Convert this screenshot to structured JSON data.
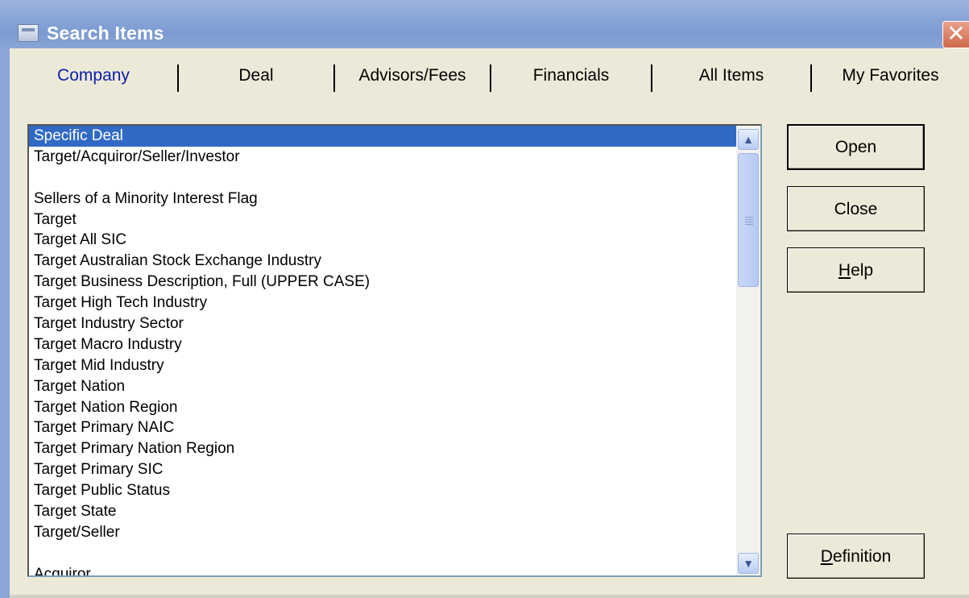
{
  "window": {
    "title": "Search Items",
    "close_glyph": "✕"
  },
  "tabs": [
    {
      "label": "Company",
      "active": true
    },
    {
      "label": "Deal",
      "active": false
    },
    {
      "label": "Advisors/Fees",
      "active": false
    },
    {
      "label": "Financials",
      "active": false
    },
    {
      "label": "All Items",
      "active": false
    },
    {
      "label": "My Favorites",
      "active": false
    }
  ],
  "list": {
    "items": [
      "Specific Deal",
      "Target/Acquiror/Seller/Investor",
      "",
      "Sellers of a Minority Interest Flag",
      "Target",
      "Target All SIC",
      "Target Australian Stock Exchange Industry",
      "Target Business Description, Full (UPPER CASE)",
      "Target High Tech Industry",
      "Target Industry Sector",
      "Target Macro Industry",
      "Target Mid Industry",
      "Target Nation",
      "Target Nation Region",
      "Target Primary NAIC",
      "Target Primary Nation Region",
      "Target Primary SIC",
      "Target Public Status",
      "Target State",
      "Target/Seller",
      "",
      "Acquiror"
    ],
    "selected_index": 0,
    "scroll_up_glyph": "▲",
    "scroll_down_glyph": "▼"
  },
  "buttons": {
    "open": "Open",
    "close": "Close",
    "help_first": "H",
    "help_rest": "elp",
    "definition_first": "D",
    "definition_rest": "efinition"
  },
  "colors": {
    "selection": "#316ac5",
    "titlebar": "#8aa6d8",
    "active_tab_text": "#0a1fa8"
  }
}
